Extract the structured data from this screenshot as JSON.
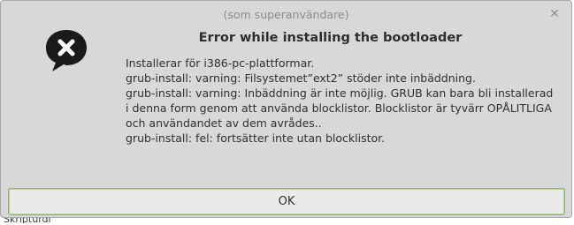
{
  "window": {
    "title": "(som superanvändare)",
    "close_icon": "close-icon"
  },
  "dialog": {
    "icon": "error-speech-bubble-icon",
    "heading": "Error while installing the bootloader",
    "message_lines": [
      "Installerar för i386-pc-plattformar.",
      "grub-install: varning: Filsystemet”ext2” stöder inte inbäddning.",
      "grub-install: varning: Inbäddning är inte möjlig. GRUB kan bara bli installerad",
      "i denna form genom att använda blocklistor. Blocklistor är tyvärr OPÅLITLIGA",
      "och användandet av dem avrådes..",
      "grub-install: fel: fortsätter inte utan blocklistor."
    ],
    "ok_label": "OK"
  },
  "background": {
    "partial_text": "Skripturdi"
  },
  "colors": {
    "dialog_bg": "#d8d8d8",
    "button_focus_border": "#8fae6f"
  }
}
